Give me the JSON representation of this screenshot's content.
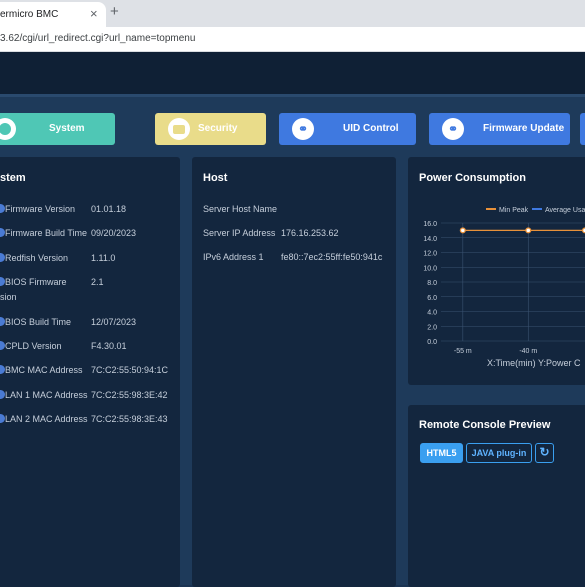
{
  "browser": {
    "tab_title": "ermicro BMC",
    "close_glyph": "×",
    "new_tab_glyph": "+",
    "url": "3.62/cgi/url_redirect.cgi?url_name=topmenu"
  },
  "nav": {
    "system": "System",
    "security": "Security",
    "uid_control": "UID Control",
    "firmware_update": "Firmware Update"
  },
  "system_panel": {
    "title": "stem",
    "rows": [
      {
        "label": "Firmware Version",
        "value": "01.01.18"
      },
      {
        "label": "Firmware Build Time",
        "value": "09/20/2023"
      },
      {
        "label": "Redfish Version",
        "value": "1.11.0"
      },
      {
        "label": "BIOS Firmware",
        "label2": "sion",
        "value": "2.1"
      },
      {
        "label": "BIOS Build Time",
        "value": "12/07/2023"
      },
      {
        "label": "CPLD Version",
        "value": "F4.30.01"
      },
      {
        "label": "BMC MAC Address",
        "value": "7C:C2:55:50:94:1C"
      },
      {
        "label": "LAN 1 MAC Address",
        "value": "7C:C2:55:98:3E:42"
      },
      {
        "label": "LAN 2 MAC Address",
        "value": "7C:C2:55:98:3E:43"
      }
    ]
  },
  "host_panel": {
    "title": "Host",
    "rows": [
      {
        "label": "Server Host Name",
        "value": ""
      },
      {
        "label": "Server IP Address",
        "value": "176.16.253.62"
      },
      {
        "label": "IPv6 Address 1",
        "value": "fe80::7ec2:55ff:fe50:941c"
      }
    ]
  },
  "power_panel": {
    "title": "Power Consumption"
  },
  "console_panel": {
    "title": "Remote Console Preview",
    "html5": "HTML5",
    "java": "JAVA plug-in",
    "refresh_glyph": "↻"
  },
  "chart_data": {
    "type": "line",
    "legend": [
      "Min Peak",
      "Average Usa"
    ],
    "legend_placement": "top",
    "colors": {
      "min_peak": "#e8913a",
      "average": "#3f79e0"
    },
    "y_ticks": [
      "16.0",
      "14.0",
      "12.0",
      "10.0",
      "8.0",
      "6.0",
      "4.0",
      "2.0",
      "0.0"
    ],
    "ylim": [
      0,
      16
    ],
    "x_ticks": [
      "-55 m",
      "-40 m"
    ],
    "x_tick_values": [
      -55,
      -40
    ],
    "xlim": [
      -60,
      -27
    ],
    "axis_caption": "X:Time(min) Y:Power C",
    "series": [
      {
        "name": "Min Peak",
        "x": [
          -55,
          -40,
          -27
        ],
        "values": [
          15,
          15,
          15
        ]
      }
    ],
    "grid": true
  }
}
